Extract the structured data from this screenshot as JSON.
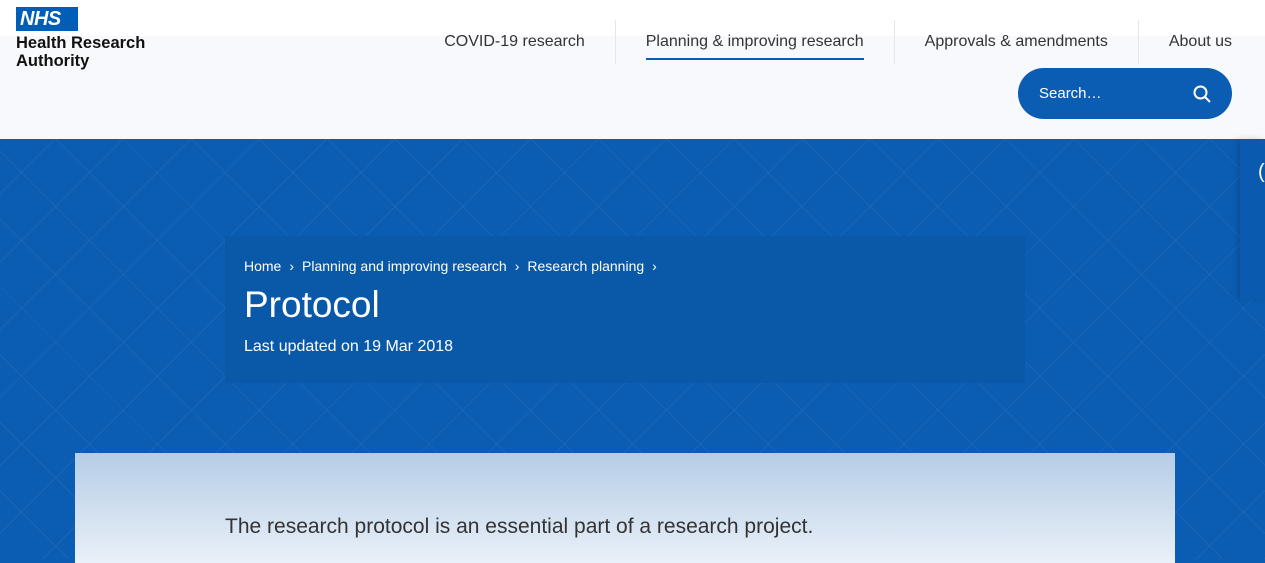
{
  "logo": {
    "badge": "NHS",
    "line1": "Health Research",
    "line2": "Authority"
  },
  "nav": [
    {
      "label": "COVID-19 research"
    },
    {
      "label": "Planning & improving research"
    },
    {
      "label": "Approvals & amendments"
    },
    {
      "label": "About us"
    }
  ],
  "search": {
    "placeholder": "Search…",
    "icon": "search-icon"
  },
  "breadcrumb": [
    {
      "label": "Home"
    },
    {
      "label": "Planning and improving research"
    },
    {
      "label": "Research planning"
    }
  ],
  "breadcrumb_sep": "›",
  "page": {
    "title": "Protocol",
    "updated": "Last updated on 19 Mar 2018",
    "intro": "The research protocol is an essential part of a research project."
  },
  "colors": {
    "brand": "#005eb8",
    "hero": "#0b5db3"
  }
}
